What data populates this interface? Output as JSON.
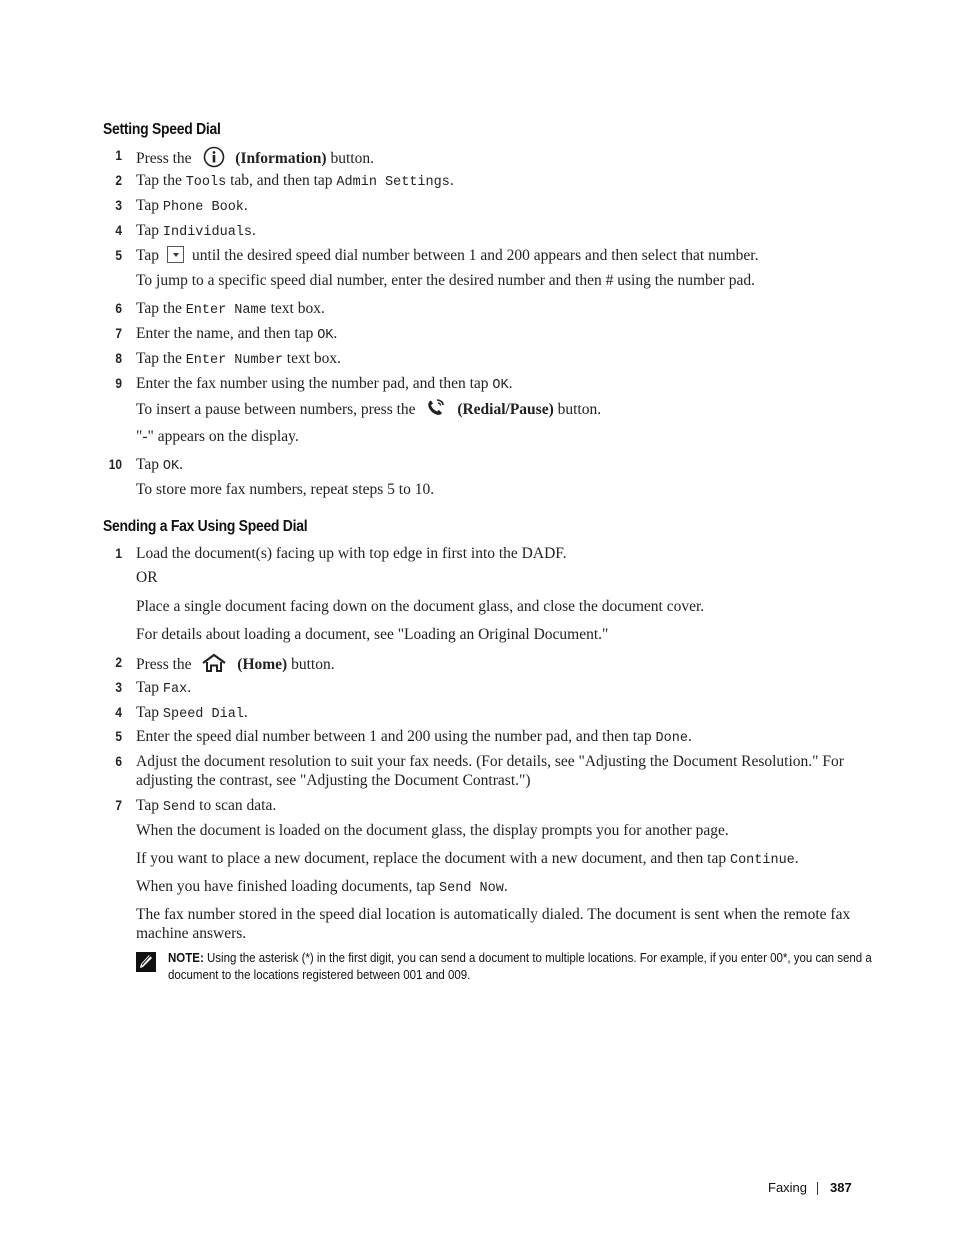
{
  "sections": [
    {
      "title": "Setting Speed Dial",
      "steps": [
        {
          "num": "1",
          "pre": "Press the",
          "icon": "information-icon",
          "bold": "(Information)",
          "post": "button."
        },
        {
          "num": "2",
          "a": "Tap the ",
          "m1": "Tools",
          "b": " tab, and then tap ",
          "m2": "Admin Settings",
          "c": "."
        },
        {
          "num": "3",
          "a": "Tap ",
          "m1": "Phone Book",
          "c": "."
        },
        {
          "num": "4",
          "a": "Tap ",
          "m1": "Individuals",
          "c": "."
        },
        {
          "num": "5",
          "a": "Tap",
          "icon": "dropdown-arrow-icon",
          "b": "until the desired speed dial number between 1 and 200 appears and then select that number.",
          "sub": "To jump to a specific speed dial number, enter the desired number and then # using the number pad."
        },
        {
          "num": "6",
          "a": "Tap the ",
          "m1": "Enter Name",
          "c": " text box."
        },
        {
          "num": "7",
          "a": "Enter the name, and then tap ",
          "m1": "OK",
          "c": "."
        },
        {
          "num": "8",
          "a": "Tap the ",
          "m1": "Enter Number",
          "c": " text box."
        },
        {
          "num": "9",
          "a": "Enter the fax number using the number pad, and then tap ",
          "m1": "OK",
          "c": ".",
          "sub_pre": "To insert a pause between numbers, press the",
          "sub_icon": "redial-pause-icon",
          "sub_bold": "(Redial/Pause)",
          "sub_post": "button.",
          "sub2": "\"-\" appears on the display."
        },
        {
          "num": "10",
          "a": "Tap ",
          "m1": "OK",
          "c": ".",
          "sub": "To store more fax numbers, repeat steps 5 to 10."
        }
      ]
    },
    {
      "title": "Sending a Fax Using Speed Dial",
      "steps": [
        {
          "num": "1",
          "a": "Load the document(s) facing up with top edge in first into the DADF.",
          "or": "OR",
          "sub": "Place a single document facing down on the document glass, and close the document cover.",
          "sub2": "For details about loading a document, see \"Loading an Original Document.\""
        },
        {
          "num": "2",
          "pre": "Press the",
          "icon": "home-icon",
          "bold": "(Home)",
          "post": "button."
        },
        {
          "num": "3",
          "a": "Tap ",
          "m1": "Fax",
          "c": "."
        },
        {
          "num": "4",
          "a": "Tap ",
          "m1": "Speed Dial",
          "c": "."
        },
        {
          "num": "5",
          "a": "Enter the speed dial number between 1 and 200 using the number pad, and then tap ",
          "m1": "Done",
          "c": "."
        },
        {
          "num": "6",
          "a": "Adjust the document resolution to suit your fax needs. (For details, see \"Adjusting the Document Resolution.\" For adjusting the contrast, see \"Adjusting the Document Contrast.\")"
        },
        {
          "num": "7",
          "a": "Tap ",
          "m1": "Send",
          "c": " to scan data.",
          "sub": "When the document is loaded on the document glass, the display prompts you for another page.",
          "sub2_a": "If you want to place a new document, replace the document with a new document, and then tap ",
          "sub2_m": "Continue",
          "sub2_c": ".",
          "sub3_a": "When you have finished loading documents, tap ",
          "sub3_m": "Send Now",
          "sub3_c": ".",
          "sub4": "The fax number stored in the speed dial location is automatically dialed. The document is sent when the remote fax machine answers."
        }
      ]
    }
  ],
  "note": {
    "label": "NOTE:",
    "text": " Using the asterisk (*) in the first digit, you can send a document to multiple locations. For example, if you enter 00*, you can send a document to the locations registered between 001 and 009."
  },
  "footer": {
    "section": "Faxing",
    "page": "387"
  }
}
